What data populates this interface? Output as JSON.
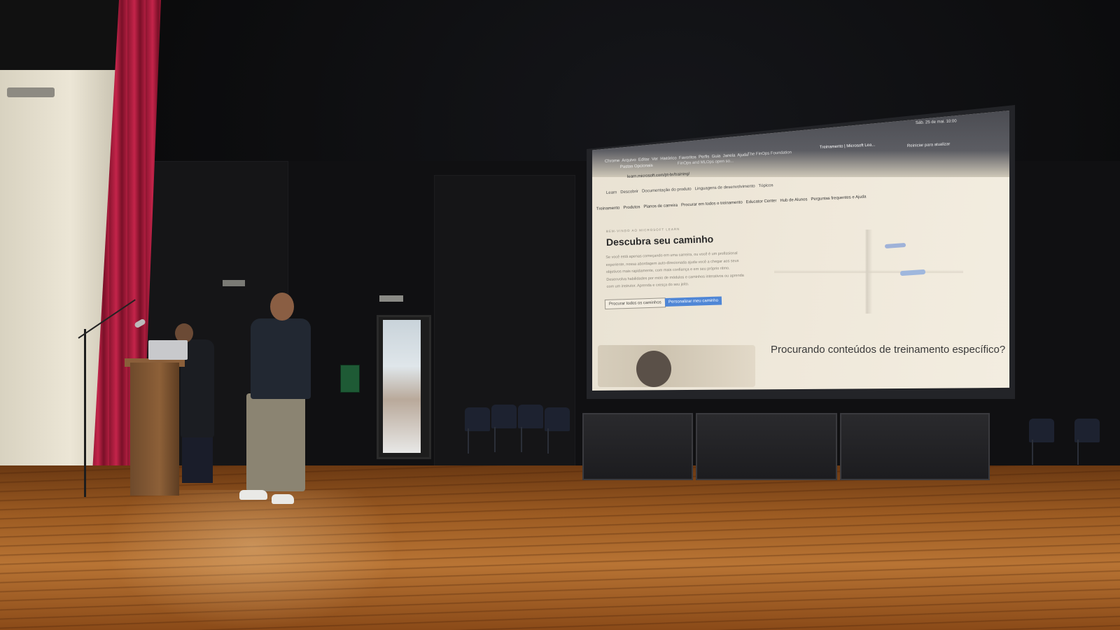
{
  "scene": {
    "description_label": "",
    "colors": {
      "curtain": "#b01e40",
      "floor": "#9c5b22",
      "screen": "#efe8da",
      "accent_button": "#4f86d6"
    }
  },
  "projection": {
    "menu_bar": [
      "Chrome",
      "Arquivo",
      "Editar",
      "Ver",
      "Histórico",
      "Favoritos",
      "Perfis",
      "Guia",
      "Janela",
      "Ajuda"
    ],
    "tab1": "FinOps and MLOps open so...",
    "tab2": "The FinOps Foundation",
    "tab3": "Treinamento | Microsoft Lea...",
    "clock": "Sáb. 25 de mai. 10:00",
    "update": "Reiniciar para atualizar",
    "bookmark": "Pastas Opcionais",
    "url": "learn.microsoft.com/pt-br/training/",
    "site_nav": [
      "Learn",
      "Descobrir",
      "Documentação do produto",
      "Linguagens de desenvolvimento",
      "Tópicos"
    ],
    "sub_nav": [
      "Treinamento",
      "Produtos",
      "Planos de carreira",
      "Procurar em todos o treinamento",
      "Educator Center",
      "Hub de Alunos",
      "Perguntas frequentes e Ajuda"
    ],
    "eyebrow": "BEM-VINDO AO MICROSOFT LEARN",
    "title": "Descubra seu caminho",
    "paragraph": "Se você está apenas começando em uma carreira, ou você é um profissional experiente, nossa abordagem auto-direcionada ajuda você a chegar aos seus objetivos mais rapidamente, com mais confiança e em seu próprio ritmo. Desenvolva habilidades por meio de módulos e caminhos interativos ou aprenda com um instrutor. Aprenda e cresça do seu jeito.",
    "button_browse": "Procurar todos os caminhos",
    "button_personalize": "Personalizar meu caminho",
    "promo": "Procurando conteúdos de treinamento específico?"
  }
}
